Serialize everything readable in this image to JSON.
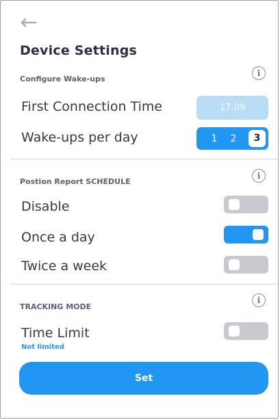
{
  "header": {
    "back_icon": "arrow-left-icon",
    "title": "Device Settings"
  },
  "wakeups": {
    "section_label": "Configure Wake-ups",
    "info_icon": "info-icon",
    "first_connection_label": "First Connection Time",
    "first_connection_value": "17:09",
    "per_day_label": "Wake-ups per day",
    "per_day_options": [
      "1",
      "2",
      "3"
    ],
    "per_day_selected": "3"
  },
  "position_report": {
    "section_label": "Postion Report SCHEDULE",
    "info_icon": "info-icon",
    "options": [
      {
        "label": "Disable",
        "on": false
      },
      {
        "label": "Once a day",
        "on": true
      },
      {
        "label": "Twice a week",
        "on": false
      }
    ]
  },
  "tracking": {
    "section_label": "TRACKING MODE",
    "info_icon": "info-icon",
    "time_limit_label": "Time Limit",
    "time_limit_on": false,
    "time_limit_value": "Not limited"
  },
  "actions": {
    "set_label": "Set"
  },
  "colors": {
    "accent": "#2196f3",
    "accent_disabled": "#b9dcf7",
    "toggle_off": "#c9cad1",
    "title": "#2c2f48"
  }
}
